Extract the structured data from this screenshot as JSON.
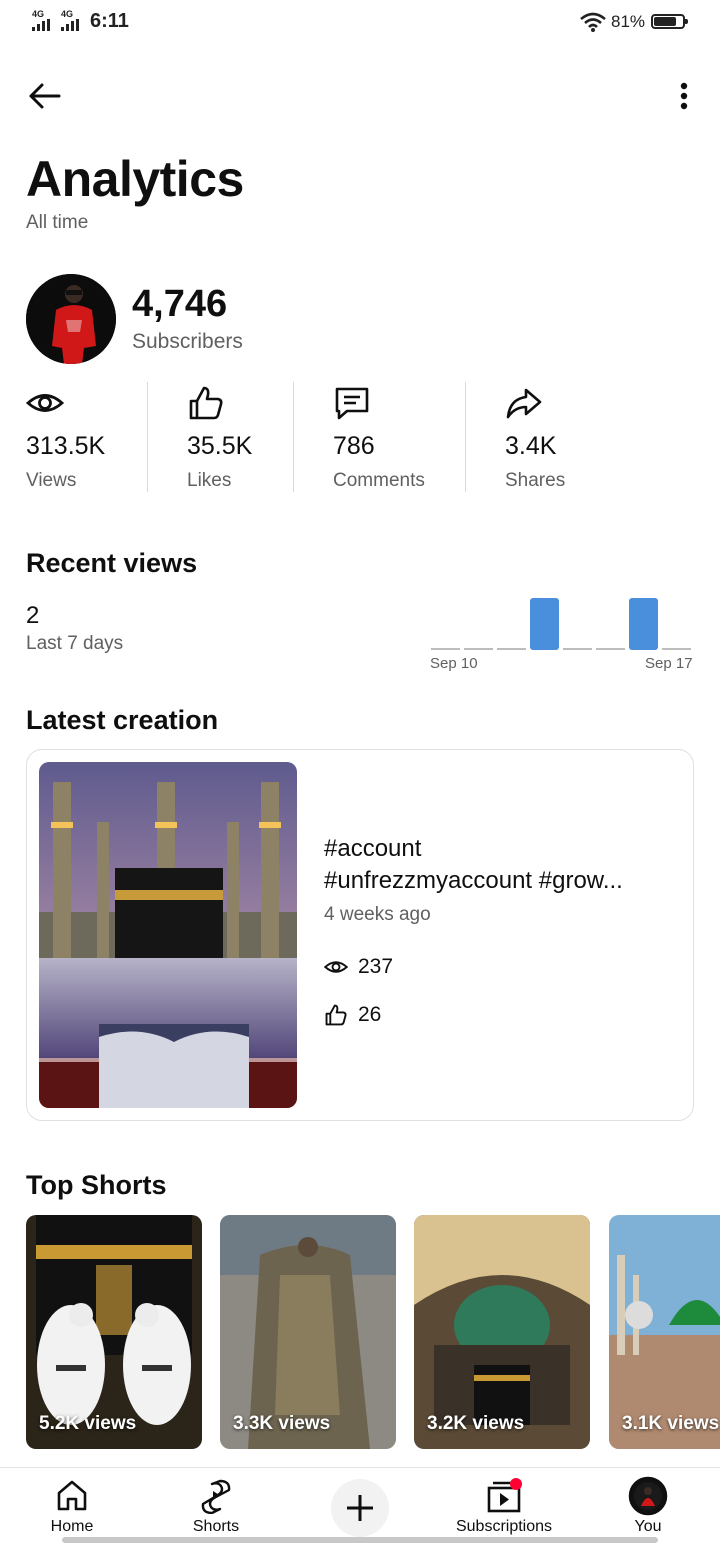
{
  "status_bar": {
    "sim1": "4G",
    "sim2": "4G",
    "time": "6:11",
    "battery": "81%",
    "battery_level": 0.81
  },
  "header": {
    "title": "Analytics",
    "subtitle": "All time"
  },
  "channel": {
    "subscribers_value": "4,746",
    "subscribers_label": "Subscribers"
  },
  "stats": [
    {
      "icon": "eye-icon",
      "value": "313.5K",
      "label": "Views"
    },
    {
      "icon": "thumbs-up-icon",
      "value": "35.5K",
      "label": "Likes"
    },
    {
      "icon": "comment-icon",
      "value": "786",
      "label": "Comments"
    },
    {
      "icon": "share-icon",
      "value": "3.4K",
      "label": "Shares"
    }
  ],
  "recent_views": {
    "title": "Recent views",
    "count": "2",
    "period": "Last 7 days",
    "start_label": "Sep 10",
    "end_label": "Sep 17"
  },
  "chart_data": {
    "type": "bar",
    "categories": [
      "",
      "",
      "",
      "",
      "",
      "",
      "",
      ""
    ],
    "values": [
      0,
      0,
      0,
      1,
      0,
      0,
      1,
      0
    ],
    "ylim": [
      0,
      1
    ],
    "xlabel": "",
    "ylabel": "",
    "title": "",
    "tick_labels": [
      "Sep 10",
      "Sep 17"
    ],
    "color": "#4a8fdc",
    "grid": false
  },
  "latest": {
    "title": "Latest creation",
    "video_title_line1": "#account",
    "video_title_line2": "#unfrezzmyaccount #grow...",
    "age": "4 weeks ago",
    "views": "237",
    "likes": "26"
  },
  "top_shorts": {
    "title": "Top Shorts",
    "items": [
      {
        "views": "5.2K views"
      },
      {
        "views": "3.3K views"
      },
      {
        "views": "3.2K views"
      },
      {
        "views": "3.1K views"
      }
    ]
  },
  "nav": {
    "home": "Home",
    "shorts": "Shorts",
    "subscriptions": "Subscriptions",
    "you": "You"
  },
  "colors": {
    "accent_bar": "#4a8fdc",
    "notification_dot": "#ff0033",
    "secondary_text": "#606060"
  }
}
